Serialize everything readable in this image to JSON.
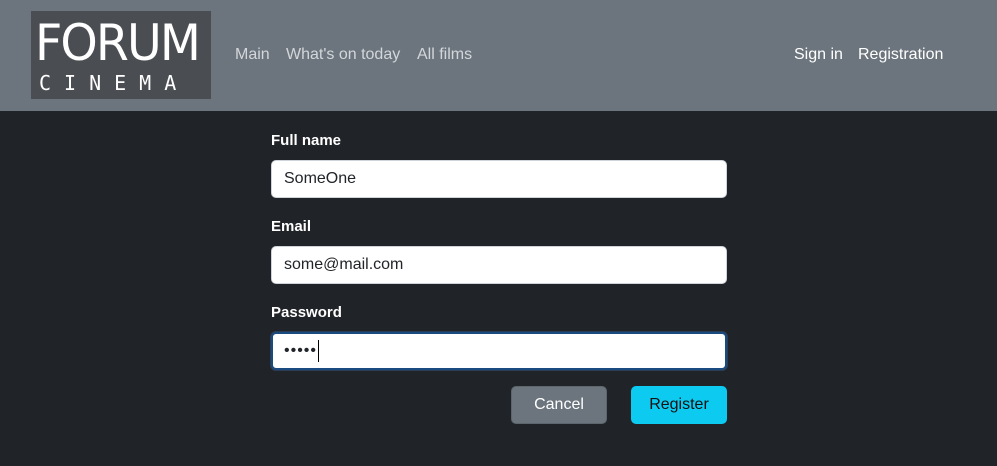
{
  "logo": {
    "line1": "FORUM",
    "line2": "CINEMA"
  },
  "nav": {
    "left": [
      "Main",
      "What's on today",
      "All films"
    ],
    "right": [
      "Sign in",
      "Registration"
    ]
  },
  "form": {
    "full_name": {
      "label": "Full name",
      "value": "SomeOne"
    },
    "email": {
      "label": "Email",
      "value": "some@mail.com"
    },
    "password": {
      "label": "Password",
      "value": "•••••"
    }
  },
  "buttons": {
    "cancel": "Cancel",
    "register": "Register"
  },
  "colors": {
    "navbar": "#6c757d",
    "background": "#202327",
    "register_button": "#0dcaf0",
    "cancel_button": "#6c757d"
  }
}
